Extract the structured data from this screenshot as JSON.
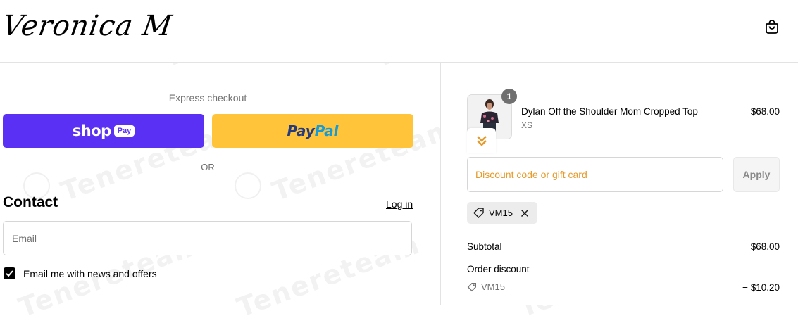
{
  "header": {
    "logo_text": "Veronica M",
    "cart_icon": "shopping-bag-icon"
  },
  "express": {
    "label": "Express checkout",
    "shop_pay": {
      "word": "shop",
      "pill": "Pay"
    },
    "paypal": {
      "part1": "Pay",
      "part2": "Pal"
    },
    "or_text": "OR"
  },
  "contact": {
    "title": "Contact",
    "login_label": "Log in",
    "email_placeholder": "Email",
    "email_value": "",
    "newsletter_label": "Email me with news and offers",
    "newsletter_checked": true
  },
  "order": {
    "item": {
      "quantity": "1",
      "name": "Dylan Off the Shoulder Mom Cropped Top",
      "variant": "XS",
      "price": "$68.00"
    },
    "discount_placeholder": "Discount code or gift card",
    "apply_label": "Apply",
    "applied_code": "VM15",
    "subtotal_label": "Subtotal",
    "subtotal_value": "$68.00",
    "order_discount_label": "Order discount",
    "discount_code_line": "VM15",
    "discount_value": "− $10.20"
  },
  "watermark": "Tenereteam",
  "colors": {
    "shop_pay": "#5a31f4",
    "paypal": "#ffc439",
    "placeholder_accent": "#e59b2c",
    "checkbox": "#000000"
  }
}
